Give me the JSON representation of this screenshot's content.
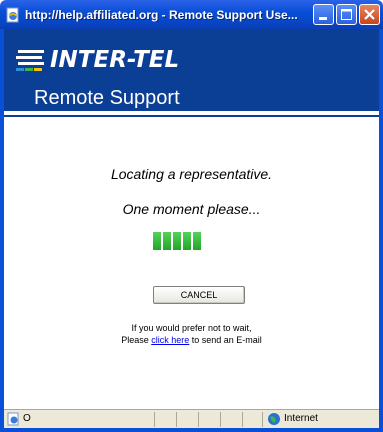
{
  "window": {
    "title": "http://help.affiliated.org - Remote Support Use...",
    "app_icon": "ie-page-icon",
    "buttons": [
      "minimize-icon",
      "maximize-icon",
      "close-icon"
    ]
  },
  "header": {
    "logo_text": "INTER-TEL",
    "subtitle": "Remote Support",
    "band_color": "#0b3f95"
  },
  "main": {
    "locating_text": "Locating a representative.",
    "moment_text": "One moment please...",
    "progress_blocks": 5,
    "progress_color": "#2fb636",
    "cancel_label": "CANCEL",
    "note_line1": "If you would prefer not to wait,",
    "note_prefix": "Please ",
    "note_link": "click here",
    "note_suffix": " to send an E-mail"
  },
  "statusbar": {
    "status_text": "O",
    "zone_text": "Internet"
  }
}
